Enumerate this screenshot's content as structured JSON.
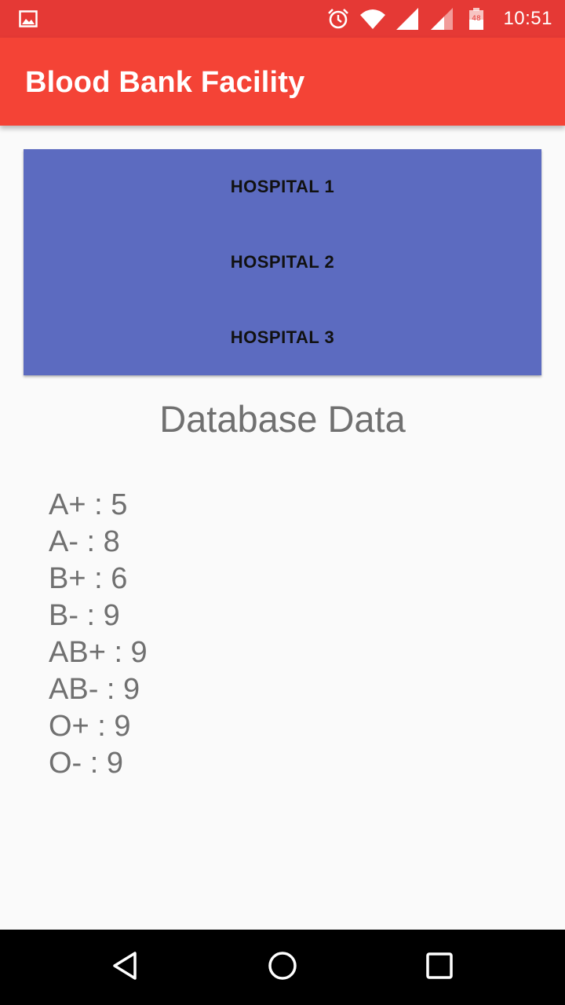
{
  "status_bar": {
    "time": "10:51",
    "battery_level": "48",
    "icons": [
      "image-notification-icon",
      "alarm-icon",
      "wifi-icon",
      "signal-icon",
      "signal-icon",
      "battery-icon"
    ]
  },
  "app_bar": {
    "title": "Blood Bank Facility",
    "color": "#F44336"
  },
  "hospitals": {
    "color": "#5C6BC0",
    "items": [
      {
        "label": "HOSPITAL 1"
      },
      {
        "label": "HOSPITAL 2"
      },
      {
        "label": "HOSPITAL 3"
      }
    ]
  },
  "database": {
    "title": "Database Data",
    "entries": [
      {
        "text": "A+ : 5"
      },
      {
        "text": "A- : 8"
      },
      {
        "text": "B+ : 6"
      },
      {
        "text": "B- : 9"
      },
      {
        "text": "AB+ : 9"
      },
      {
        "text": "AB- : 9"
      },
      {
        "text": "O+ : 9"
      },
      {
        "text": "O- : 9"
      }
    ]
  },
  "nav_bar": {
    "buttons": [
      "back-icon",
      "home-icon",
      "recents-icon"
    ]
  }
}
